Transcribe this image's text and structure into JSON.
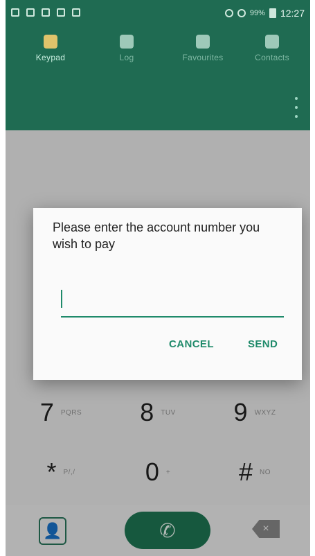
{
  "status_bar": {
    "time": "12:27",
    "battery": "99%"
  },
  "tabs": [
    {
      "label": "Keypad",
      "active": true
    },
    {
      "label": "Log",
      "active": false
    },
    {
      "label": "Favourites",
      "active": false
    },
    {
      "label": "Contacts",
      "active": false
    }
  ],
  "dialog": {
    "message": "Please enter the account number you wish to pay",
    "input_value": "",
    "cancel_label": "CANCEL",
    "send_label": "SEND"
  },
  "keypad": [
    {
      "digit": "7",
      "letters": "PQRS"
    },
    {
      "digit": "8",
      "letters": "TUV"
    },
    {
      "digit": "9",
      "letters": "WXYZ"
    },
    {
      "digit": "*",
      "letters": "P/,/"
    },
    {
      "digit": "0",
      "letters": "+"
    },
    {
      "digit": "#",
      "letters": "NO"
    }
  ],
  "colors": {
    "accent": "#1f6b52",
    "accent_text": "#1f8a6a"
  },
  "icons": {
    "contacts": "contact-card-icon",
    "call": "phone-icon",
    "backspace": "backspace-icon",
    "menu": "kebab-icon"
  }
}
